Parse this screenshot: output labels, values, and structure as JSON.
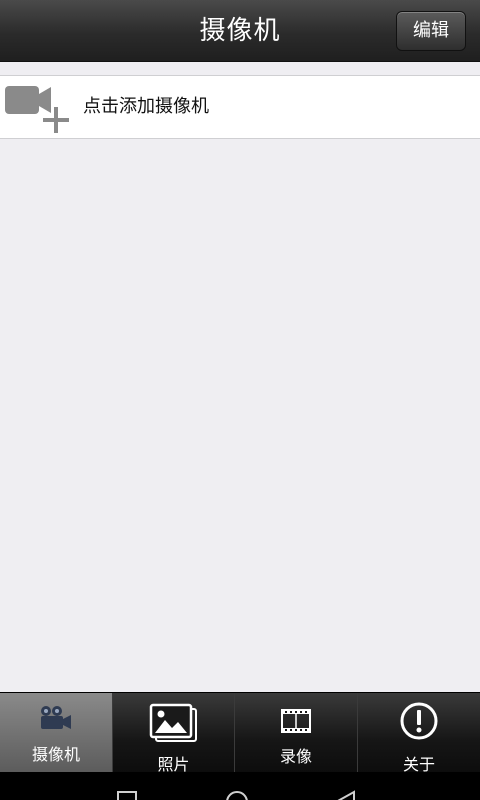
{
  "header": {
    "title": "摄像机",
    "edit_label": "编辑"
  },
  "add_camera": {
    "label": "点击添加摄像机",
    "icon": "video-camera-add-icon"
  },
  "tabs": [
    {
      "label": "摄像机",
      "icon": "camera-tab-icon",
      "active": true
    },
    {
      "label": "照片",
      "icon": "photo-icon",
      "active": false
    },
    {
      "label": "录像",
      "icon": "film-icon",
      "active": false
    },
    {
      "label": "关于",
      "icon": "info-icon",
      "active": false
    }
  ],
  "system_nav": [
    {
      "icon": "recent-apps-icon"
    },
    {
      "icon": "home-icon"
    },
    {
      "icon": "back-icon"
    }
  ],
  "colors": {
    "background": "#efeef2",
    "titlebar": "#2b2b2b",
    "active_tab": "#7a7a7a",
    "icon_gray": "#8a8a8a"
  }
}
